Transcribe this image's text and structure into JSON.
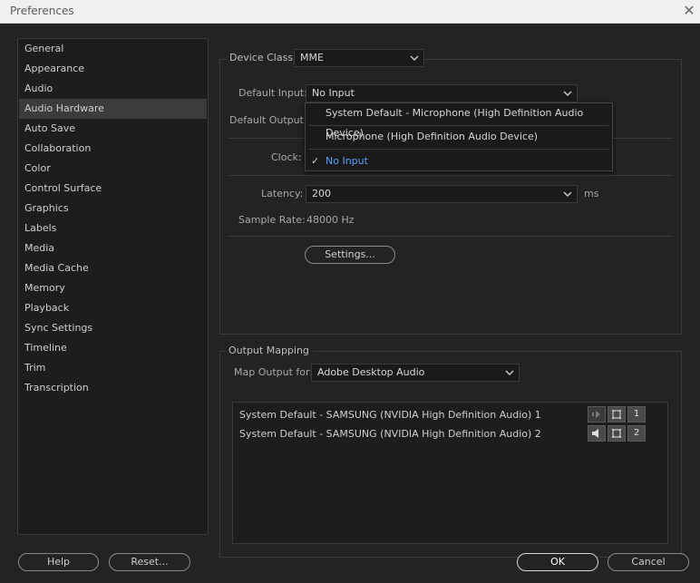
{
  "window": {
    "title": "Preferences"
  },
  "sidebar": {
    "items": [
      {
        "label": "General"
      },
      {
        "label": "Appearance"
      },
      {
        "label": "Audio"
      },
      {
        "label": "Audio Hardware",
        "selected": true
      },
      {
        "label": "Auto Save"
      },
      {
        "label": "Collaboration"
      },
      {
        "label": "Color"
      },
      {
        "label": "Control Surface"
      },
      {
        "label": "Graphics"
      },
      {
        "label": "Labels"
      },
      {
        "label": "Media"
      },
      {
        "label": "Media Cache"
      },
      {
        "label": "Memory"
      },
      {
        "label": "Playback"
      },
      {
        "label": "Sync Settings"
      },
      {
        "label": "Timeline"
      },
      {
        "label": "Trim"
      },
      {
        "label": "Transcription"
      }
    ]
  },
  "device": {
    "device_class_label": "Device Class:",
    "device_class_value": "MME",
    "default_input_label": "Default Input:",
    "default_input_value": "No Input",
    "default_output_label": "Default Output:",
    "clock_label": "Clock:",
    "latency_label": "Latency:",
    "latency_value": "200",
    "latency_unit": "ms",
    "sample_rate_label": "Sample Rate:",
    "sample_rate_value": "48000 Hz",
    "settings_button": "Settings..."
  },
  "input_popup": {
    "options": [
      {
        "label": "System Default - Microphone (High Definition Audio Device)",
        "checked": false
      },
      {
        "label": "Microphone (High Definition Audio Device)",
        "checked": false
      },
      {
        "label": "No Input",
        "checked": true
      }
    ],
    "check_glyph": "✓"
  },
  "output_mapping": {
    "legend": "Output Mapping",
    "map_for_label": "Map Output for:",
    "map_for_value": "Adobe Desktop Audio",
    "rows": [
      {
        "label": "System Default - SAMSUNG (NVIDIA High Definition Audio) 1",
        "channel": "1"
      },
      {
        "label": "System Default - SAMSUNG (NVIDIA High Definition Audio) 2",
        "channel": "2"
      }
    ]
  },
  "footer": {
    "help_button": "Help",
    "reset_button": "Reset...",
    "ok_button": "OK",
    "cancel_button": "Cancel"
  },
  "colors": {
    "background": "#232323",
    "selected_item": "#3c3c3c",
    "checked_option": "#5aa0ff"
  }
}
